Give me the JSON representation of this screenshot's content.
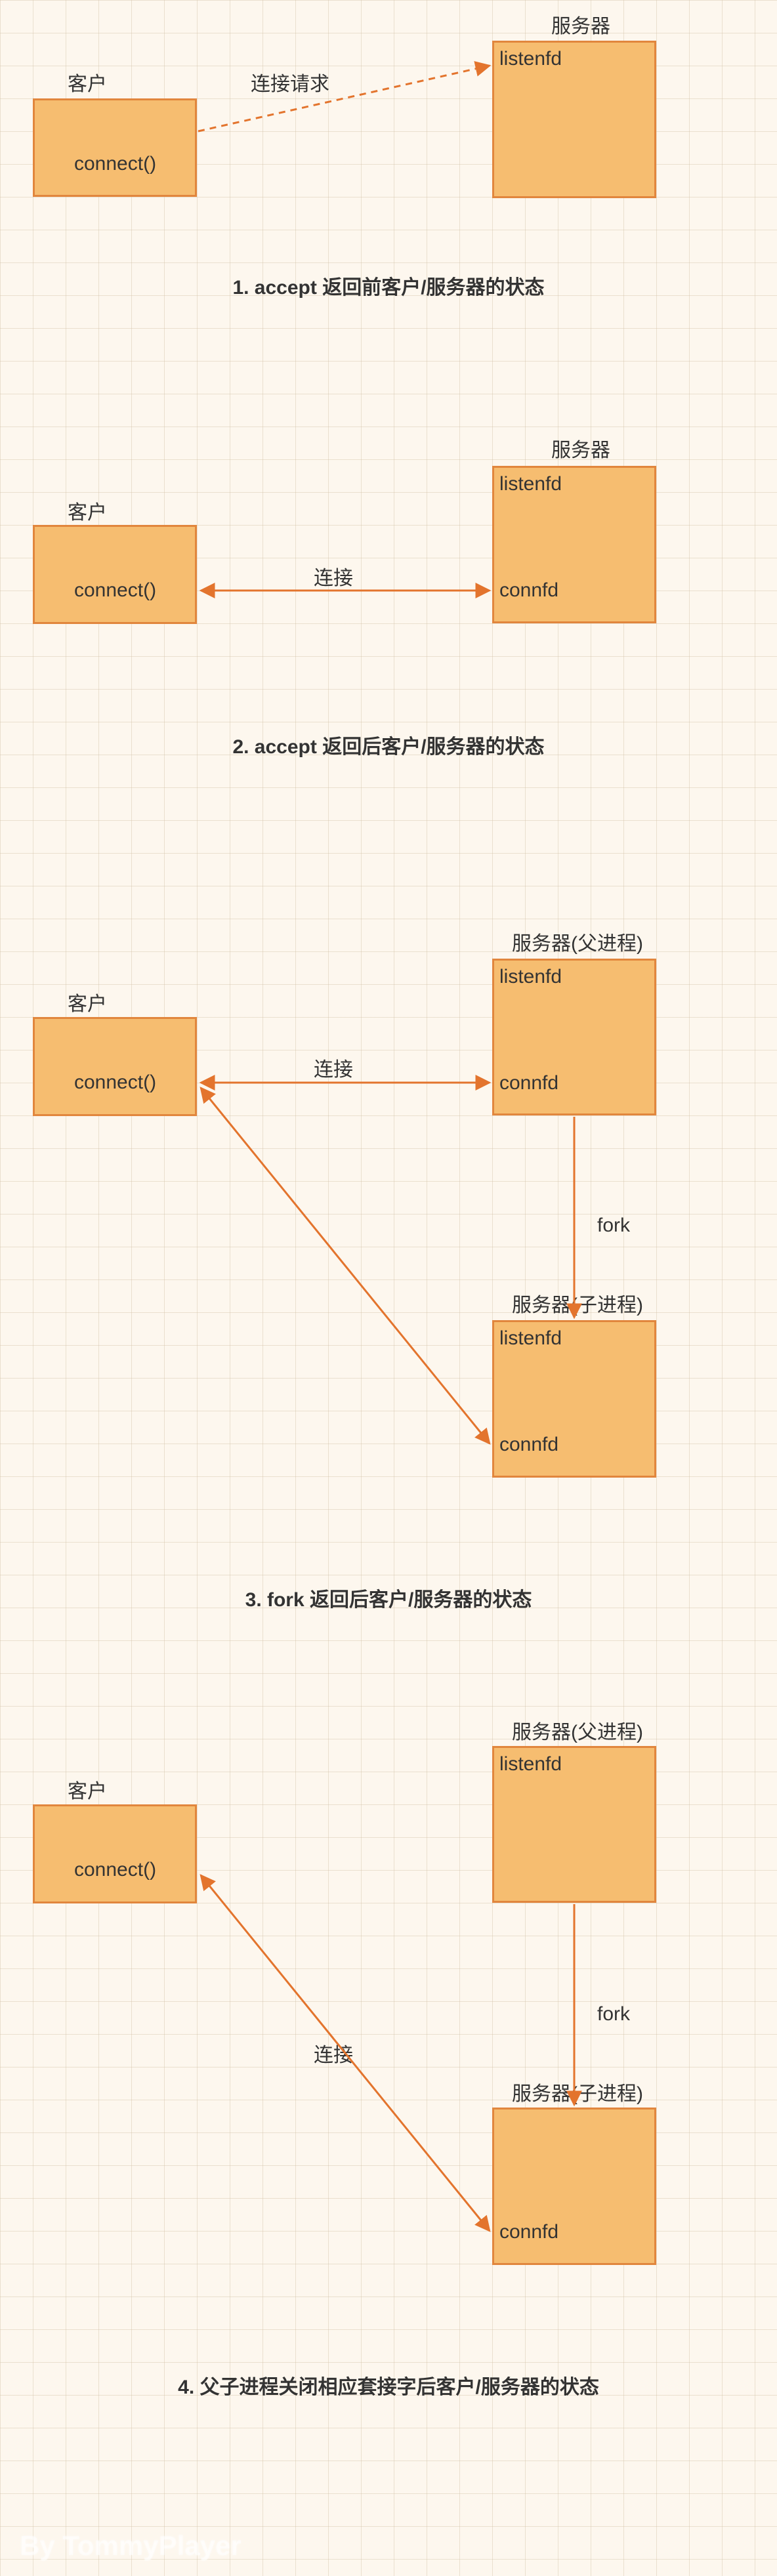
{
  "labels": {
    "client": "客户",
    "server": "服务器",
    "server_parent": "服务器(父进程)",
    "server_child": "服务器(子进程)",
    "connect": "connect()",
    "listenfd": "listenfd",
    "connfd": "connfd",
    "connection_request": "连接请求",
    "connection": "连接",
    "fork": "fork"
  },
  "captions": {
    "s1": "1. accept 返回前客户/服务器的状态",
    "s2": "2. accept 返回后客户/服务器的状态",
    "s3": "3. fork 返回后客户/服务器的状态",
    "s4": "4. 父子进程关闭相应套接字后客户/服务器的状态"
  },
  "watermark": "By TommyPlayer",
  "chart_data": {
    "type": "diagram",
    "description": "TCP concurrent server process states before/after accept, after fork, and after closing sockets",
    "scenes": [
      {
        "id": 1,
        "title": "1. accept 返回前客户/服务器的状态",
        "nodes": [
          {
            "id": "client",
            "label": "客户",
            "text": "connect()"
          },
          {
            "id": "server",
            "label": "服务器",
            "text": [
              "listenfd"
            ]
          }
        ],
        "edges": [
          {
            "from": "client",
            "to": "server",
            "label": "连接请求",
            "style": "dashed",
            "direction": "to"
          }
        ]
      },
      {
        "id": 2,
        "title": "2. accept 返回后客户/服务器的状态",
        "nodes": [
          {
            "id": "client",
            "label": "客户",
            "text": "connect()"
          },
          {
            "id": "server",
            "label": "服务器",
            "text": [
              "listenfd",
              "connfd"
            ]
          }
        ],
        "edges": [
          {
            "from": "client",
            "to": "server.connfd",
            "label": "连接",
            "style": "solid",
            "direction": "both"
          }
        ]
      },
      {
        "id": 3,
        "title": "3. fork 返回后客户/服务器的状态",
        "nodes": [
          {
            "id": "client",
            "label": "客户",
            "text": "connect()"
          },
          {
            "id": "server_parent",
            "label": "服务器(父进程)",
            "text": [
              "listenfd",
              "connfd"
            ]
          },
          {
            "id": "server_child",
            "label": "服务器(子进程)",
            "text": [
              "listenfd",
              "connfd"
            ]
          }
        ],
        "edges": [
          {
            "from": "client",
            "to": "server_parent.connfd",
            "label": "连接",
            "style": "solid",
            "direction": "both"
          },
          {
            "from": "client",
            "to": "server_child.connfd",
            "style": "solid",
            "direction": "both"
          },
          {
            "from": "server_parent",
            "to": "server_child",
            "label": "fork",
            "style": "solid",
            "direction": "to"
          }
        ]
      },
      {
        "id": 4,
        "title": "4. 父子进程关闭相应套接字后客户/服务器的状态",
        "nodes": [
          {
            "id": "client",
            "label": "客户",
            "text": "connect()"
          },
          {
            "id": "server_parent",
            "label": "服务器(父进程)",
            "text": [
              "listenfd"
            ]
          },
          {
            "id": "server_child",
            "label": "服务器(子进程)",
            "text": [
              "connfd"
            ]
          }
        ],
        "edges": [
          {
            "from": "client",
            "to": "server_child.connfd",
            "label": "连接",
            "style": "solid",
            "direction": "both"
          },
          {
            "from": "server_parent",
            "to": "server_child",
            "label": "fork",
            "style": "solid",
            "direction": "to"
          }
        ]
      }
    ]
  }
}
